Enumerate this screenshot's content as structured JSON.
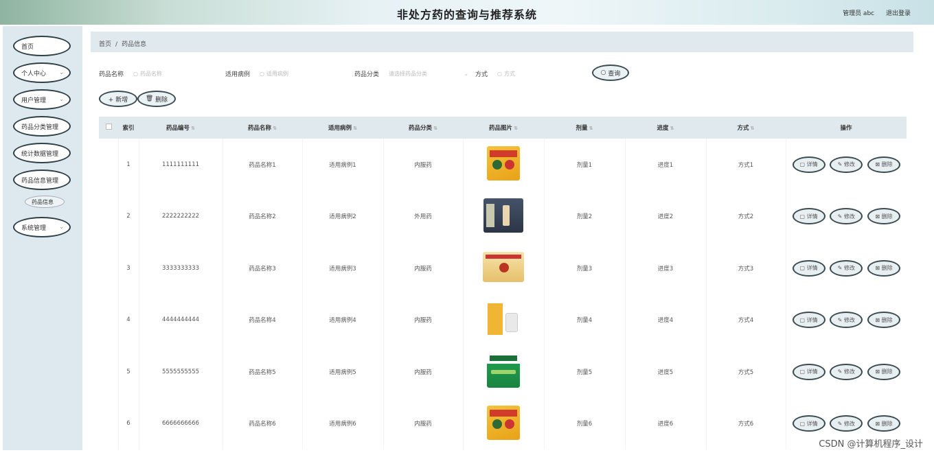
{
  "app": {
    "title": "非处方药的查询与推荐系统"
  },
  "header": {
    "user_label": "管理员 abc",
    "logout_label": "退出登录"
  },
  "sidebar": {
    "items": [
      {
        "label": "首页",
        "has_chevron": false
      },
      {
        "label": "个人中心",
        "has_chevron": true
      },
      {
        "label": "用户管理",
        "has_chevron": true
      },
      {
        "label": "药品分类管理",
        "has_chevron": false
      },
      {
        "label": "统计数据管理",
        "has_chevron": false
      },
      {
        "label": "药品信息管理",
        "has_chevron": false
      },
      {
        "label": "药品信息",
        "sub": true
      },
      {
        "label": "系统管理",
        "has_chevron": true
      }
    ]
  },
  "breadcrumb": {
    "home": "首页",
    "separator": "/",
    "current": "药品信息"
  },
  "filters": {
    "name_label": "药品名称",
    "name_placeholder": "药品名称",
    "indication_label": "适用病例",
    "indication_placeholder": "适用病例",
    "category_label": "药品分类",
    "category_placeholder": "请选择药品分类",
    "method_label": "方式",
    "method_placeholder": "方式",
    "search_button": "查询"
  },
  "toolbar": {
    "add_button": "+ 新增",
    "delete_button": "删除"
  },
  "table": {
    "columns": [
      "索引",
      "药品编号",
      "药品名称",
      "适用病例",
      "药品分类",
      "药品图片",
      "剂量",
      "进度",
      "方式",
      "操作"
    ],
    "rows": [
      {
        "index": "1",
        "code": "1111111111",
        "name": "药品名称1",
        "indication": "适用病例1",
        "category": "内服药",
        "image": "yellow-medicine-box",
        "dose": "剂量1",
        "progress": "进度1",
        "method": "方式1"
      },
      {
        "index": "2",
        "code": "2222222222",
        "name": "药品名称2",
        "indication": "适用病例2",
        "category": "外用药",
        "image": "medicine-bottles",
        "dose": "剂量2",
        "progress": "进度2",
        "method": "方式2"
      },
      {
        "index": "3",
        "code": "3333333333",
        "name": "药品名称3",
        "indication": "适用病例3",
        "category": "内服药",
        "image": "medicine-carton",
        "dose": "剂量3",
        "progress": "进度3",
        "method": "方式3"
      },
      {
        "index": "4",
        "code": "4444444444",
        "name": "药品名称4",
        "indication": "适用病例4",
        "category": "内服药",
        "image": "pill-bottle",
        "dose": "剂量4",
        "progress": "进度4",
        "method": "方式4"
      },
      {
        "index": "5",
        "code": "5555555555",
        "name": "药品名称5",
        "indication": "适用病例5",
        "category": "内服药",
        "image": "green-granule-box",
        "dose": "剂量5",
        "progress": "进度5",
        "method": "方式5"
      },
      {
        "index": "6",
        "code": "6666666666",
        "name": "药品名称6",
        "indication": "适用病例6",
        "category": "内服药",
        "image": "yellow-medicine-box",
        "dose": "剂量6",
        "progress": "进度6",
        "method": "方式6"
      }
    ],
    "actions": {
      "detail": "详情",
      "edit": "修改",
      "delete": "删除"
    }
  },
  "watermark": "CSDN @计算机程序_设计",
  "colors": {
    "header_accent": "#8fb4a0",
    "sidebar_bg": "#dde9ee",
    "table_head_bg": "#dfe9ee"
  }
}
